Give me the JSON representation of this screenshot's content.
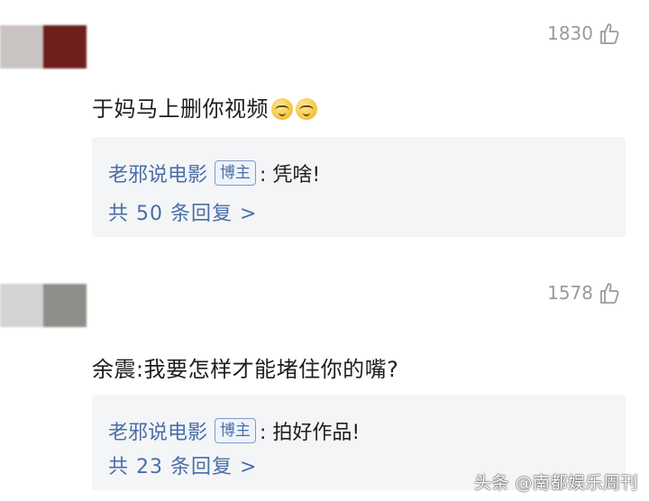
{
  "comments": [
    {
      "likes": "1830",
      "text": "于妈马上删你视频",
      "emoji_names": [
        "grin-emoji",
        "grin-emoji"
      ],
      "reply": {
        "author": "老邪说电影",
        "badge": "博主",
        "text": ": 凭啥!"
      },
      "more": "共 50 条回复 >"
    },
    {
      "likes": "1578",
      "text": "余震:我要怎样才能堵住你的嘴?",
      "reply": {
        "author": "老邪说电影",
        "badge": "博主",
        "text": ": 拍好作品!"
      },
      "more": "共 23 条回复 >"
    }
  ],
  "avatar_colors": [
    [
      "#c9c3c2",
      "#6e1e1c"
    ],
    [
      "#d3d3d3",
      "#8e8e8a"
    ]
  ],
  "watermark": "头条 @南都娱乐周刊",
  "colors": {
    "link": "#4a6ea8",
    "reply_bg": "#f4f5f7",
    "muted": "#9a9a9a"
  }
}
